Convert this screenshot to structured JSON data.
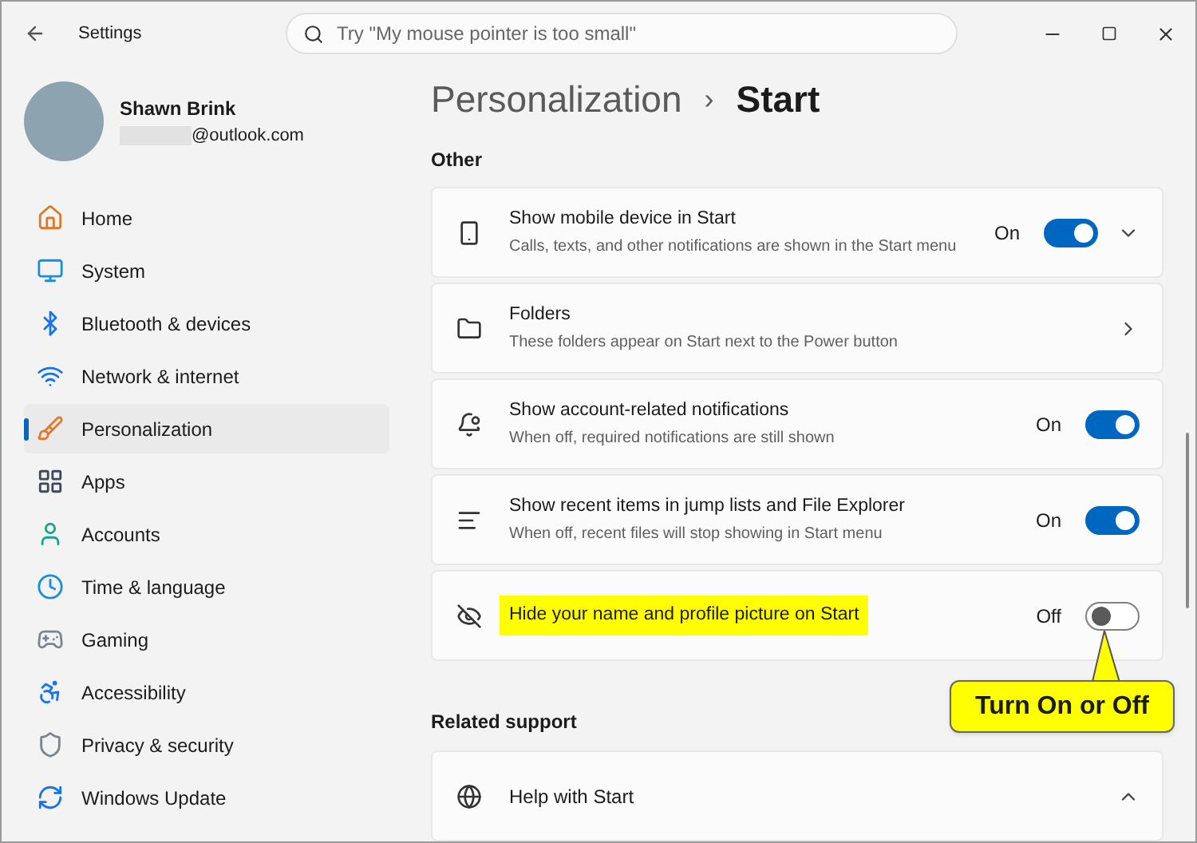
{
  "window": {
    "title": "Settings"
  },
  "search": {
    "placeholder": "Try \"My mouse pointer is too small\""
  },
  "account": {
    "name": "Shawn Brink",
    "email": "@outlook.com"
  },
  "sidebar": {
    "items": [
      {
        "label": "Home",
        "selected": false
      },
      {
        "label": "System",
        "selected": false
      },
      {
        "label": "Bluetooth & devices",
        "selected": false
      },
      {
        "label": "Network & internet",
        "selected": false
      },
      {
        "label": "Personalization",
        "selected": true
      },
      {
        "label": "Apps",
        "selected": false
      },
      {
        "label": "Accounts",
        "selected": false
      },
      {
        "label": "Time & language",
        "selected": false
      },
      {
        "label": "Gaming",
        "selected": false
      },
      {
        "label": "Accessibility",
        "selected": false
      },
      {
        "label": "Privacy & security",
        "selected": false
      },
      {
        "label": "Windows Update",
        "selected": false
      }
    ]
  },
  "breadcrumb": {
    "parent": "Personalization",
    "separator": "›",
    "current": "Start"
  },
  "section": {
    "title": "Other",
    "rows": [
      {
        "kind": "toggle",
        "title": "Show mobile device in Start",
        "description": "Calls, texts, and other notifications are shown in the Start menu",
        "on": true,
        "state_label": "On",
        "expanded": false,
        "highlighted": false
      },
      {
        "kind": "link",
        "title": "Folders",
        "description": "These folders appear on Start next to the Power button",
        "highlighted": false
      },
      {
        "kind": "toggle",
        "title": "Show account-related notifications",
        "description": "When off, required notifications are still shown",
        "on": true,
        "state_label": "On",
        "highlighted": false
      },
      {
        "kind": "toggle",
        "title": "Show recent items in jump lists and File Explorer",
        "description": "When off, recent files will stop showing in Start menu",
        "on": true,
        "state_label": "On",
        "highlighted": false
      },
      {
        "kind": "toggle",
        "title": "Hide your name and profile picture on Start",
        "on": false,
        "state_label": "Off",
        "highlighted": true
      }
    ]
  },
  "callout": {
    "text": "Turn On or Off"
  },
  "related": {
    "title": "Related support",
    "items": [
      {
        "title": "Help with Start",
        "expanded": true
      }
    ]
  }
}
